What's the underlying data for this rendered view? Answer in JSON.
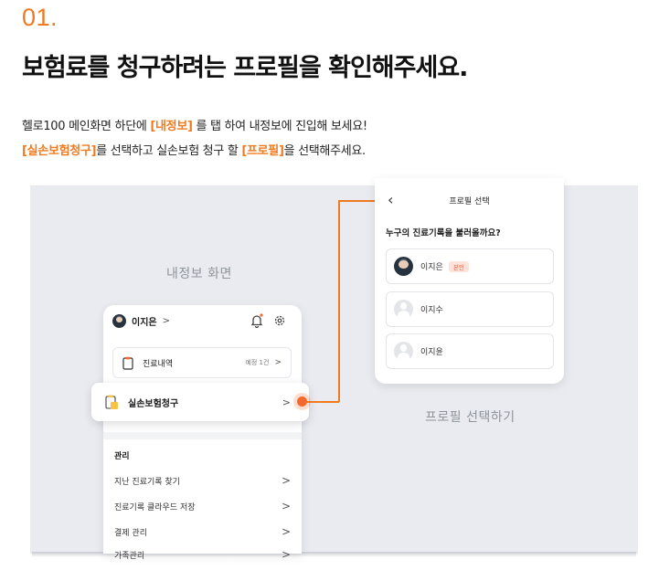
{
  "step": "01.",
  "heading": "보험료를 청구하려는 프로필을 확인해주세요.",
  "desc_line1": {
    "pre": "헬로100 메인화면 하단에 ",
    "hl": "[내정보]",
    "post": " 를 탭 하여 내정보에 진입해 보세요!"
  },
  "desc_line2": {
    "hl1": "[실손보험청구]",
    "mid": "를 선택하고 실손보험 청구 할 ",
    "hl2": "[프로필]",
    "post": "을 선택해주세요."
  },
  "captions": {
    "left": "내정보 화면",
    "right": "프로필 선택하기"
  },
  "left_screen": {
    "user_name": "이지은",
    "user_chevron": ">",
    "medical_history": "진료내역",
    "reservation_text": "예정 1건",
    "reservation_chevron": ">",
    "insurance_claim": "실손보험청구",
    "insurance_chevron": ">",
    "section_title": "관리",
    "menu_items": [
      {
        "label": "지난 진료기록 찾기",
        "chevron": ">"
      },
      {
        "label": "진료기록 클라우드 저장",
        "chevron": ">"
      },
      {
        "label": "결제 관리",
        "chevron": ">"
      },
      {
        "label": "가족관리",
        "chevron": ">"
      }
    ]
  },
  "right_screen": {
    "back": "‹",
    "title": "프로필 선택",
    "question": "누구의 진료기록을 불러올까요?",
    "profiles": [
      {
        "name": "이지은",
        "badge": "본인"
      },
      {
        "name": "이지수",
        "badge": ""
      },
      {
        "name": "이지윤",
        "badge": ""
      }
    ]
  },
  "colors": {
    "accent": "#f07a1f",
    "stage_bg": "#e9ebf0",
    "badge_bg": "#fde3dc",
    "badge_text": "#ef5a3c"
  },
  "icons": [
    "bell-icon",
    "gear-icon",
    "document-icon",
    "insurance-doc-icon",
    "back-icon",
    "chevron-right-icon",
    "avatar"
  ]
}
